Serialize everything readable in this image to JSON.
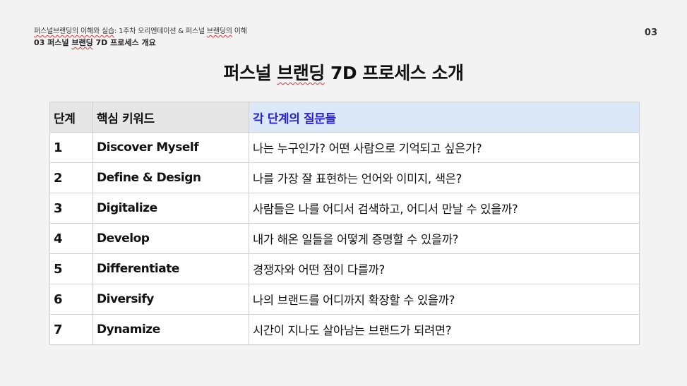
{
  "header": {
    "breadcrumb_a": "퍼스널브랜딩의 이해와 실습",
    "breadcrumb_b": ": 1주차 오리엔테이션 &  퍼스널 ",
    "breadcrumb_c": "브랜딩의",
    "breadcrumb_d": " 이해",
    "subhead_a": "03 퍼스널 ",
    "subhead_b": "브랜딩",
    "subhead_c": " 7D 프로세스 개요",
    "page_number": "03"
  },
  "title": {
    "part1": "퍼스널 ",
    "part2": "브랜딩",
    "part3": " 7D 프로세스 소개"
  },
  "table": {
    "headers": [
      "단계",
      "핵심 키워드",
      "각 단계의 질문들"
    ],
    "rows": [
      {
        "step": "1",
        "keyword": "Discover Myself",
        "question": "나는 누구인가? 어떤 사람으로 기억되고 싶은가?"
      },
      {
        "step": "2",
        "keyword": "Define & Design",
        "question": "나를 가장 잘 표현하는 언어와 이미지, 색은?"
      },
      {
        "step": "3",
        "keyword": "Digitalize",
        "question": "사람들은 나를 어디서 검색하고, 어디서 만날 수 있을까?"
      },
      {
        "step": "4",
        "keyword": "Develop",
        "question": "내가 해온 일들을 어떻게 증명할 수 있을까?"
      },
      {
        "step": "5",
        "keyword": "Differentiate",
        "question": "경쟁자와 어떤 점이 다를까?"
      },
      {
        "step": "6",
        "keyword": "Diversify",
        "question": "나의 브랜드를 어디까지 확장할 수 있을까?"
      },
      {
        "step": "7",
        "keyword": "Dynamize",
        "question": "시간이 지나도 살아남는 브랜드가 되려면?"
      }
    ]
  },
  "colors": {
    "background": "#f3f3f3",
    "header_gray": "#e6e6e6",
    "header_blue": "#dbe8f8",
    "header_blue_text": "#2a1fd0",
    "spellcheck_underline": "#d33"
  }
}
